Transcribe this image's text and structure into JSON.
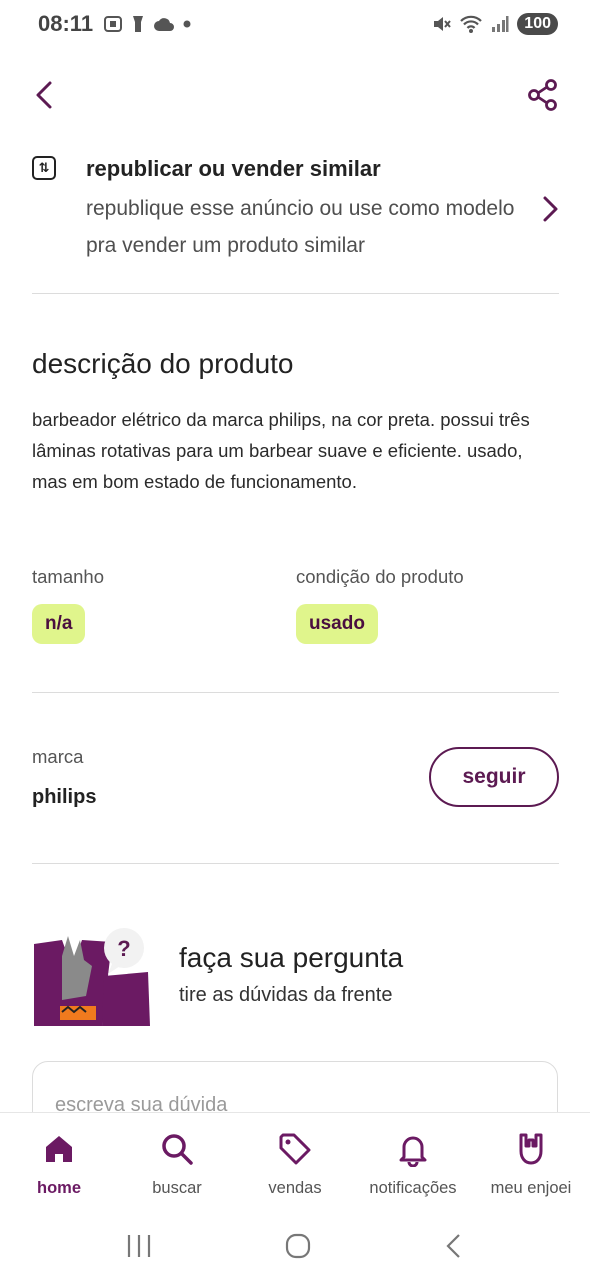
{
  "status": {
    "time": "08:11",
    "battery": "100"
  },
  "colors": {
    "accent": "#6b1a63",
    "pill_bg": "#e0f58c",
    "pill_text": "#4a0e3f"
  },
  "republish": {
    "title": "republicar ou vender similar",
    "description": "republique esse anúncio ou use como modelo pra vender um produto similar"
  },
  "description": {
    "title": "descrição do produto",
    "text": "barbeador elétrico da marca philips, na cor preta. possui três lâminas rotativas para um barbear suave e eficiente. usado, mas em bom estado de funcionamento."
  },
  "attributes": {
    "size": {
      "label": "tamanho",
      "value": "n/a"
    },
    "condition": {
      "label": "condição do produto",
      "value": "usado"
    }
  },
  "brand": {
    "label": "marca",
    "value": "philips",
    "follow_label": "seguir"
  },
  "question": {
    "title": "faça sua pergunta",
    "subtitle": "tire as dúvidas da frente",
    "placeholder": "escreva sua dúvida"
  },
  "tabs": [
    {
      "label": "home",
      "icon": "home-icon",
      "active": true
    },
    {
      "label": "buscar",
      "icon": "search-icon"
    },
    {
      "label": "vendas",
      "icon": "tag-icon"
    },
    {
      "label": "notificações",
      "icon": "bell-icon"
    },
    {
      "label": "meu enjoei",
      "icon": "rock-hand-icon"
    }
  ]
}
